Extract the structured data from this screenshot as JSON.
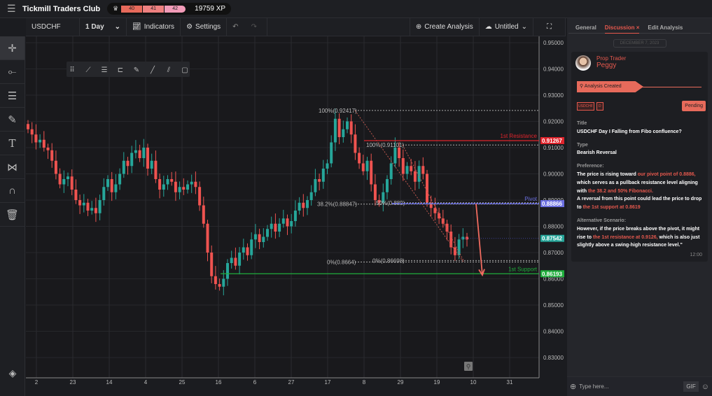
{
  "app": {
    "title": "Tickmill Traders Club",
    "levels": [
      "40",
      "41",
      "42"
    ],
    "xp": "19759 XP"
  },
  "toolbar": {
    "symbol": "USDCHF",
    "interval": "1 Day",
    "indicators": "Indicators",
    "settings": "Settings",
    "create": "Create Analysis",
    "file": "Untitled"
  },
  "left_tools": [
    "crosshair-icon",
    "horizontal-line-icon",
    "multi-line-icon",
    "brush-icon",
    "text-icon",
    "pattern-icon",
    "magnet-icon",
    "trash-icon"
  ],
  "float_tools": [
    "drag-handle-icon",
    "trend-line-icon",
    "parallel-channel-icon",
    "fib-icon",
    "brush-icon",
    "line-icon",
    "ray-icon",
    "rectangle-icon"
  ],
  "colors": {
    "up": "#26a69a",
    "down": "#ef5350",
    "resistance": "#e0242c",
    "pivot": "#6b6fe0",
    "support": "#1fae3c",
    "accent": "#e5584d"
  },
  "chart_data": {
    "type": "candlestick",
    "ylim": [
      0.825,
      0.95
    ],
    "y_ticks": [
      "0.95000",
      "0.94000",
      "0.93000",
      "0.92000",
      "0.91000",
      "0.90000",
      "0.89000",
      "0.88000",
      "0.87000",
      "0.86000",
      "0.85000",
      "0.84000",
      "0.83000"
    ],
    "x_ticks": [
      "2",
      "23",
      "14",
      "4",
      "25",
      "16",
      "6",
      "27",
      "17",
      "8",
      "29",
      "19",
      "10",
      "31"
    ],
    "close": [
      0.917,
      0.915,
      0.912,
      0.913,
      0.91,
      0.909,
      0.905,
      0.9,
      0.896,
      0.898,
      0.899,
      0.894,
      0.89,
      0.888,
      0.889,
      0.886,
      0.887,
      0.885,
      0.89,
      0.895,
      0.898,
      0.893,
      0.896,
      0.9,
      0.905,
      0.903,
      0.908,
      0.909,
      0.906,
      0.91,
      0.902,
      0.905,
      0.898,
      0.894,
      0.896,
      0.898,
      0.897,
      0.893,
      0.895,
      0.894,
      0.896,
      0.897,
      0.895,
      0.888,
      0.881,
      0.87,
      0.861,
      0.858,
      0.857,
      0.86,
      0.866,
      0.868,
      0.865,
      0.87,
      0.872,
      0.869,
      0.875,
      0.877,
      0.874,
      0.876,
      0.879,
      0.881,
      0.878,
      0.881,
      0.883,
      0.88,
      0.882,
      0.886,
      0.889,
      0.887,
      0.89,
      0.893,
      0.898,
      0.897,
      0.902,
      0.904,
      0.912,
      0.921,
      0.914,
      0.917,
      0.92,
      0.915,
      0.908,
      0.904,
      0.901,
      0.905,
      0.896,
      0.89,
      0.889,
      0.893,
      0.898,
      0.904,
      0.91,
      0.906,
      0.9,
      0.903,
      0.901,
      0.897,
      0.903,
      0.9,
      0.889,
      0.887,
      0.885,
      0.883,
      0.881,
      0.878,
      0.872,
      0.869,
      0.875,
      0.876,
      0.875
    ],
    "levels": [
      {
        "label": "1st Resistance",
        "price": 0.91267,
        "tag": "0.91267",
        "color": "#e0242c"
      },
      {
        "label": "Pivot",
        "price": 0.88866,
        "tag": "0.88866",
        "color": "#6b6fe0"
      },
      {
        "label": "1st Support",
        "price": 0.86193,
        "tag": "0.86193",
        "color": "#1fae3c"
      }
    ],
    "current_price": {
      "price": 0.87542,
      "tag": "0.87542"
    },
    "fib_labels": [
      {
        "text": "100%(0.92417)",
        "price": 0.92417
      },
      {
        "text": "38.2%(0.88847)",
        "price": 0.88847
      },
      {
        "text": "0%(0.8664)",
        "price": 0.8664
      },
      {
        "text": "100%(0.91101)",
        "price": 0.91101
      },
      {
        "text": "50%(0.889)",
        "price": 0.889
      },
      {
        "text": "0%(0.86698)",
        "price": 0.86698
      }
    ]
  },
  "panel": {
    "tabs": [
      "General",
      "Discussion",
      "Edit Analysis"
    ],
    "date": "DECEMBER 7, 2023",
    "role": "Prop Trader",
    "name": "Peggy",
    "status_event": "Analysis Created",
    "tags": [
      "USDCHF",
      "D"
    ],
    "status": "Pending",
    "title_label": "Title",
    "title": "USDCHF Day I Falling from Fibo confluence?",
    "type_label": "Type",
    "type": "Bearish Reversal",
    "pref_label": "Preference:",
    "pref": [
      "The price is rising toward ",
      "our pivot point of 0.8886,",
      " which serves as a pullback resistance level aligning with ",
      "the 38.2 and 50% Fibonacci.",
      "A reversal from this point could lead the price to drop to ",
      "the 1st support at 0.8619"
    ],
    "alt_label": "Alternative Scenario:",
    "alt": [
      "However, if the price breaks above the pivot, it might rise to ",
      "the 1st resistance at 0.9126,",
      " which is also just slightly above a swing-high resistance level.\""
    ],
    "time": "12:00",
    "placeholder": "Type here...",
    "gif": "GIF"
  }
}
